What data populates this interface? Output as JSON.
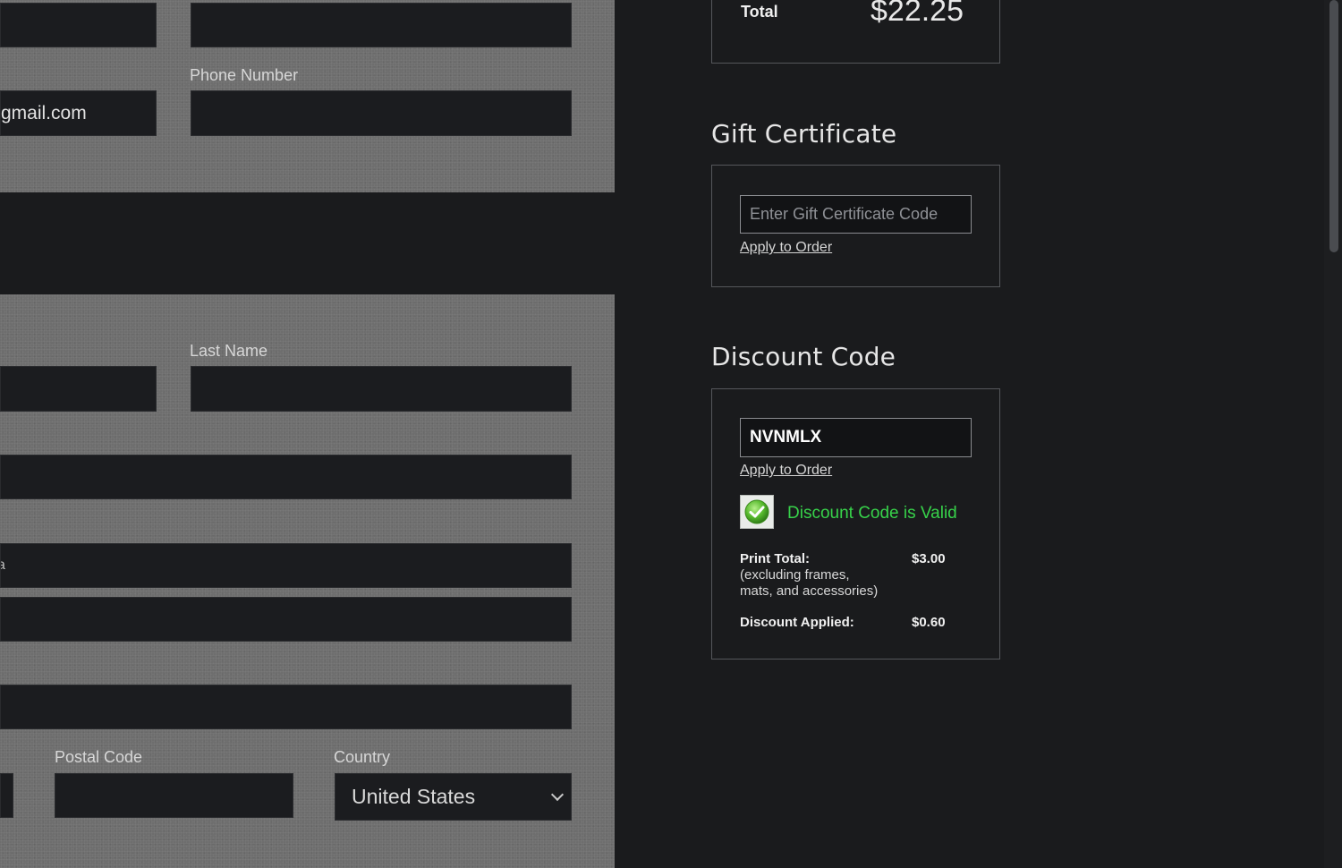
{
  "billing_form": {
    "email_value": "gmail.com",
    "phone_label": "Phone Number",
    "phone_value": ""
  },
  "shipping_form": {
    "last_name_label": "Last Name",
    "postal_code_label": "Postal Code",
    "country_label": "Country",
    "country_selected": "United States"
  },
  "order_total": {
    "label": "Total",
    "amount": "$22.25"
  },
  "gift_certificate": {
    "heading": "Gift Certificate",
    "placeholder": "Enter Gift Certificate Code",
    "apply_label": "Apply to Order"
  },
  "discount_code": {
    "heading": "Discount Code",
    "code_value": "NVNMLX",
    "apply_label": "Apply to Order",
    "status_text": "Discount Code is Valid",
    "status_color": "#37d24a",
    "print_total_label": "Print Total:",
    "print_total_note_1": "(excluding frames,",
    "print_total_note_2": "mats, and accessories)",
    "print_total_value": "$3.00",
    "discount_applied_label": "Discount Applied:",
    "discount_applied_value": "$0.60"
  },
  "colors": {
    "page_background": "#1a1b1d",
    "form_panel": "#6e6e6e",
    "valid_green": "#37d24a"
  }
}
